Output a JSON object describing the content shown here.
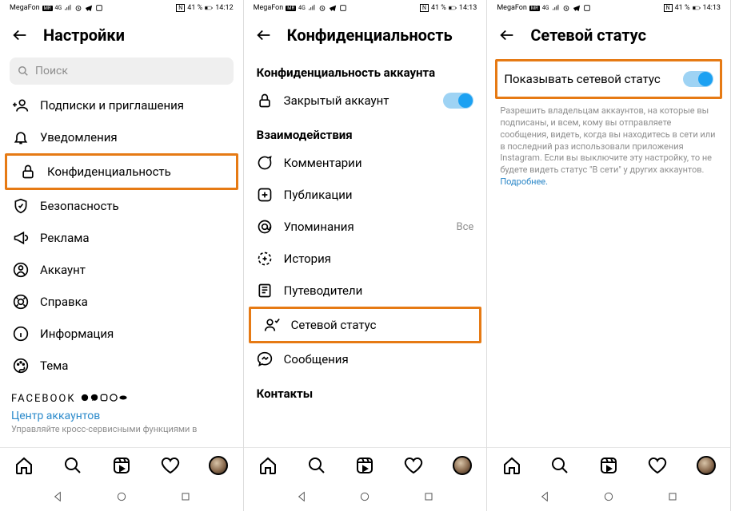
{
  "status": {
    "carrier": "MegaFon",
    "nfc": "N",
    "battery1": "41 %",
    "time1": "14:12",
    "time2": "14:13",
    "time3": "14:13"
  },
  "screen1": {
    "title": "Настройки",
    "search_placeholder": "Поиск",
    "items": [
      {
        "label": "Подписки и приглашения"
      },
      {
        "label": "Уведомления"
      },
      {
        "label": "Конфиденциальность"
      },
      {
        "label": "Безопасность"
      },
      {
        "label": "Реклама"
      },
      {
        "label": "Аккаунт"
      },
      {
        "label": "Справка"
      },
      {
        "label": "Информация"
      },
      {
        "label": "Тема"
      }
    ],
    "footer_brand": "FACEBOOK",
    "footer_link": "Центр аккаунтов",
    "footer_desc": "Управляйте кросс-сервисными функциями в"
  },
  "screen2": {
    "title": "Конфиденциальность",
    "section1": "Конфиденциальность аккаунта",
    "private_account": "Закрытый аккаунт",
    "section2": "Взаимодействия",
    "items2": [
      {
        "label": "Комментарии"
      },
      {
        "label": "Публикации"
      },
      {
        "label": "Упоминания",
        "right": "Все"
      },
      {
        "label": "История"
      },
      {
        "label": "Путеводители"
      },
      {
        "label": "Сетевой статус"
      },
      {
        "label": "Сообщения"
      }
    ],
    "section3": "Контакты"
  },
  "screen3": {
    "title": "Сетевой статус",
    "toggle_label": "Показывать сетевой статус",
    "desc": "Разрешить владельцам аккаунтов, на которые вы подписаны, и всем, кому вы отправляете сообщения, видеть, когда вы находитесь в сети или в последний раз использовали приложения Instagram. Если вы выключите эту настройку, то не будете видеть статус \"В сети\" у других аккаунтов. ",
    "more": "Подробнее."
  }
}
